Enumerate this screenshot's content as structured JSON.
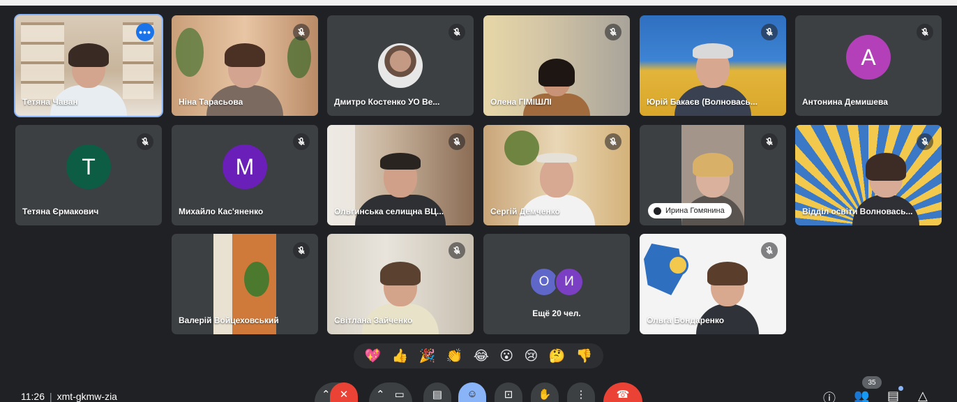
{
  "participants": [
    {
      "name": "Тетяна Чаван"
    },
    {
      "name": "Ніна Тарасьова"
    },
    {
      "name": "Дмитро Костенко УО Ве..."
    },
    {
      "name": "Олена ГІМІШЛІ"
    },
    {
      "name": "Юрій Бакаєв (Волновась..."
    },
    {
      "name": "Антонина Демишева",
      "initial": "A",
      "color": "#b340b9"
    },
    {
      "name": "Тетяна Єрмакович",
      "initial": "T",
      "color": "#0d5c44"
    },
    {
      "name": "Михайло Кас'яненко",
      "initial": "M",
      "color": "#6a1fb8"
    },
    {
      "name": "Ольгинська селищна ВЦ..."
    },
    {
      "name": "Сергій Демченко"
    },
    {
      "name": "Ирина Гомянина"
    },
    {
      "name": "Відділ освіти Волновась..."
    },
    {
      "name": "Валерій Войцеховський"
    },
    {
      "name": "Світлана Зайченко"
    },
    {
      "name": "Ольга Бондаренко"
    }
  ],
  "overflow": {
    "label": "Ещё 20 чел.",
    "avatars": [
      {
        "initial": "O",
        "color": "#5f67c9"
      },
      {
        "initial": "И",
        "color": "#7b3fc4"
      }
    ]
  },
  "reactions": [
    "💖",
    "👍",
    "🎉",
    "👏",
    "😂",
    "😮",
    "😢",
    "🤔",
    "👎"
  ],
  "meeting": {
    "time": "11:26",
    "code": "xmt-gkmw-zia"
  },
  "people_count": "35",
  "colors": {
    "background": "#202124",
    "tile": "#3c4043",
    "active_outline": "#8ab4f8",
    "end_call": "#ea4335"
  }
}
